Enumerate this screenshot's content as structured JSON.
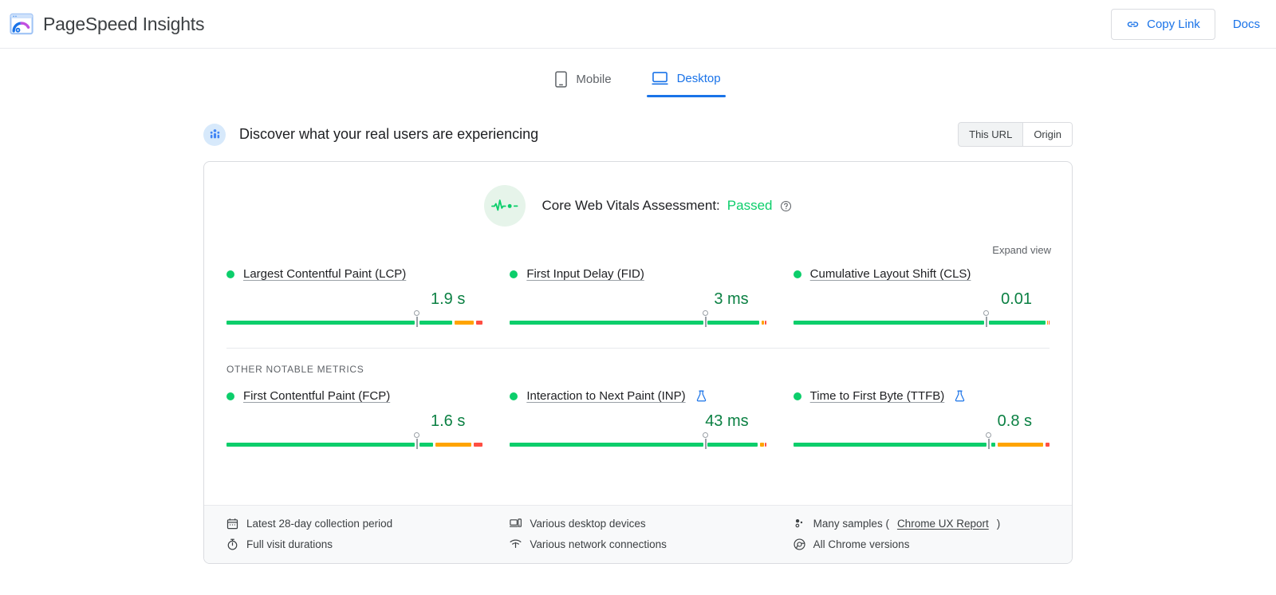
{
  "header": {
    "brand_title": "PageSpeed Insights",
    "logo_icon": "pagespeed-logo-icon",
    "copy_link_label": "Copy Link",
    "copy_link_icon": "link-icon",
    "docs_label": "Docs",
    "accent_color": "#1a73e8"
  },
  "tabs": [
    {
      "label": "Mobile",
      "icon": "mobile-phone-icon",
      "active": false
    },
    {
      "label": "Desktop",
      "icon": "desktop-monitor-icon",
      "active": true
    }
  ],
  "section": {
    "title": "Discover what your real users are experiencing",
    "badge_icon": "users-group-icon",
    "scope_options": [
      {
        "label": "This URL",
        "active": true
      },
      {
        "label": "Origin",
        "active": false
      }
    ]
  },
  "assessment": {
    "icon": "pulse-heartbeat-icon",
    "label": "Core Web Vitals Assessment:",
    "status": "Passed",
    "status_color": "#0cce6b",
    "help_icon": "help-circle-icon",
    "expand_label": "Expand view"
  },
  "core_metrics": [
    {
      "name": "Largest Contentful Paint (LCP)",
      "value": "1.9 s",
      "status_color": "#0cce6b",
      "marker_pct": 74,
      "segments": [
        {
          "color": "#0cce6b",
          "start": 0,
          "end": 73.4
        },
        {
          "color": "#0cce6b",
          "start": 75.2,
          "end": 88
        },
        {
          "color": "#ffa400",
          "start": 89,
          "end": 96.5
        },
        {
          "color": "#ff4e42",
          "start": 97.4,
          "end": 100
        }
      ]
    },
    {
      "name": "First Input Delay (FID)",
      "value": "3 ms",
      "status_color": "#0cce6b",
      "marker_pct": 76,
      "segments": [
        {
          "color": "#0cce6b",
          "start": 0,
          "end": 75.4
        },
        {
          "color": "#0cce6b",
          "start": 77.2,
          "end": 97.4
        },
        {
          "color": "#ffa400",
          "start": 98.2,
          "end": 99.2
        },
        {
          "color": "#ff4e42",
          "start": 99.6,
          "end": 100
        }
      ]
    },
    {
      "name": "Cumulative Layout Shift (CLS)",
      "value": "0.01",
      "status_color": "#0cce6b",
      "marker_pct": 75,
      "segments": [
        {
          "color": "#0cce6b",
          "start": 0,
          "end": 74.4
        },
        {
          "color": "#0cce6b",
          "start": 76.2,
          "end": 98.4
        },
        {
          "color": "#ffa400",
          "start": 99,
          "end": 99.5
        },
        {
          "color": "#ff4e42",
          "start": 99.7,
          "end": 100
        }
      ]
    }
  ],
  "other_metrics_header": "OTHER NOTABLE METRICS",
  "other_metrics": [
    {
      "name": "First Contentful Paint (FCP)",
      "value": "1.6 s",
      "status_color": "#0cce6b",
      "marker_pct": 74,
      "experimental": false,
      "segments": [
        {
          "color": "#0cce6b",
          "start": 0,
          "end": 73.4
        },
        {
          "color": "#0cce6b",
          "start": 75.2,
          "end": 80.5
        },
        {
          "color": "#ffa400",
          "start": 81.5,
          "end": 95.5
        },
        {
          "color": "#ff4e42",
          "start": 96.5,
          "end": 100
        }
      ]
    },
    {
      "name": "Interaction to Next Paint (INP)",
      "value": "43 ms",
      "status_color": "#0cce6b",
      "marker_pct": 76,
      "experimental": true,
      "experimental_icon": "flask-icon",
      "segments": [
        {
          "color": "#0cce6b",
          "start": 0,
          "end": 75.4
        },
        {
          "color": "#0cce6b",
          "start": 77.2,
          "end": 96.8
        },
        {
          "color": "#ffa400",
          "start": 97.6,
          "end": 99.2
        },
        {
          "color": "#ff4e42",
          "start": 99.6,
          "end": 100
        }
      ]
    },
    {
      "name": "Time to First Byte (TTFB)",
      "value": "0.8 s",
      "status_color": "#0cce6b",
      "marker_pct": 76,
      "experimental": true,
      "experimental_icon": "flask-icon",
      "segments": [
        {
          "color": "#0cce6b",
          "start": 0,
          "end": 75.4
        },
        {
          "color": "#0cce6b",
          "start": 77.2,
          "end": 78.8
        },
        {
          "color": "#ffa400",
          "start": 79.8,
          "end": 97.5
        },
        {
          "color": "#ff4e42",
          "start": 98.3,
          "end": 100
        }
      ]
    }
  ],
  "meta": [
    {
      "icon": "calendar-icon",
      "text": "Latest 28-day collection period",
      "link": null
    },
    {
      "icon": "devices-icon",
      "text": "Various desktop devices",
      "link": null
    },
    {
      "icon": "samples-icon",
      "text": "Many samples (",
      "link": "Chrome UX Report",
      "text_after": ")"
    },
    {
      "icon": "stopwatch-icon",
      "text": "Full visit durations",
      "link": null
    },
    {
      "icon": "wifi-icon",
      "text": "Various network connections",
      "link": null
    },
    {
      "icon": "chrome-icon",
      "text": "All Chrome versions",
      "link": null
    }
  ]
}
